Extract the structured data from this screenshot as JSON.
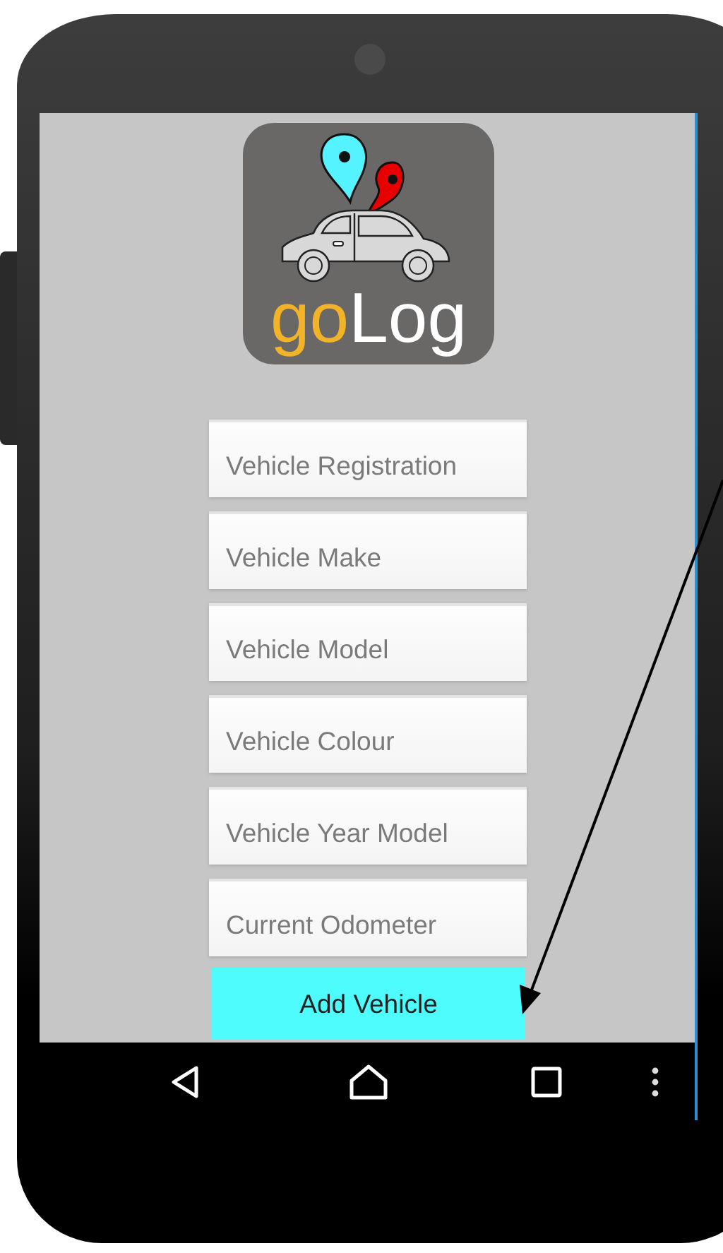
{
  "logo": {
    "words": [
      {
        "text": "go",
        "color": "#f2b328"
      },
      {
        "text": "Log",
        "color": "#ffffff"
      }
    ]
  },
  "fields": [
    {
      "placeholder": "Vehicle Registration"
    },
    {
      "placeholder": "Vehicle Make"
    },
    {
      "placeholder": "Vehicle Model"
    },
    {
      "placeholder": "Vehicle Colour"
    },
    {
      "placeholder": "Vehicle Year Model"
    },
    {
      "placeholder": "Current Odometer"
    }
  ],
  "button": {
    "label": "Add Vehicle"
  }
}
